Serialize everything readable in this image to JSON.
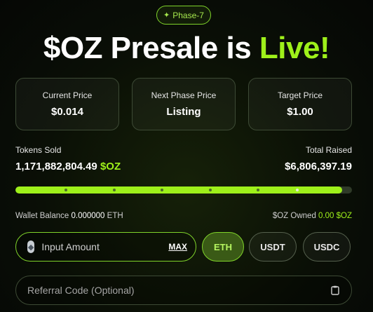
{
  "phase": {
    "icon": "sparkle-icon",
    "label": "Phase-7"
  },
  "headline": {
    "prefix": "$OZ Presale is ",
    "highlight": "Live!"
  },
  "stats": [
    {
      "label": "Current Price",
      "value": "$0.014"
    },
    {
      "label": "Next Phase Price",
      "value": "Listing"
    },
    {
      "label": "Target Price",
      "value": "$1.00"
    }
  ],
  "sale": {
    "tokens_sold_label": "Tokens Sold",
    "tokens_sold_value": "1,171,882,804.49",
    "token_symbol": "$OZ",
    "total_raised_label": "Total Raised",
    "total_raised_value": "$6,806,397.19",
    "progress_fraction": 0.97
  },
  "wallet": {
    "balance_label": "Wallet Balance",
    "balance_value": "0.000000",
    "balance_unit": "ETH",
    "owned_label": "$OZ Owned",
    "owned_value": "0.00 $OZ"
  },
  "purchase": {
    "amount_placeholder": "Input Amount",
    "max_label": "MAX",
    "currencies": [
      "ETH",
      "USDT",
      "USDC"
    ],
    "selected_currency": "ETH",
    "currency_icon": "eth-icon",
    "referral_placeholder": "Referral Code (Optional)",
    "referral_icon": "clipboard-icon"
  },
  "colors": {
    "accent": "#9ef01a",
    "accent_dark": "#3a5a16",
    "background": "#0a0f06"
  }
}
